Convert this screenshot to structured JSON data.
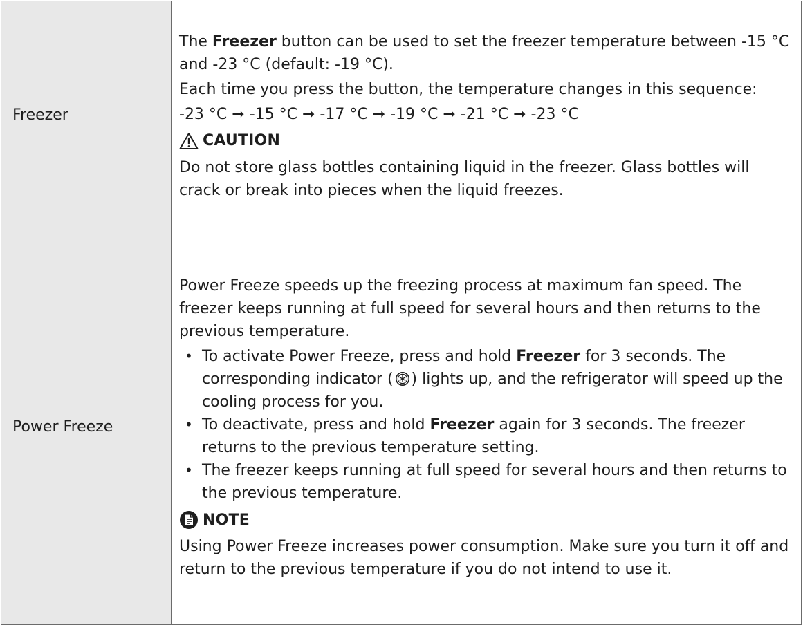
{
  "rows": [
    {
      "label": "Freezer",
      "p1_pre": "The ",
      "p1_bold": "Freezer",
      "p1_post": " button can be used to set the freezer temperature between -15 °C and -23 °C (default: -19 °C).",
      "p2": "Each time you press the button, the temperature changes in this sequence:",
      "sequence": "-23 °C ➞ -15 °C ➞ -17 °C ➞ -19 °C ➞ -21 °C ➞ -23 °C",
      "callout_title": "CAUTION",
      "callout_icon": "warning-triangle-icon",
      "callout_text": "Do not store glass bottles containing liquid in the freezer. Glass bottles will crack or break into pieces when the liquid freezes."
    },
    {
      "label": "Power Freeze",
      "intro": "Power Freeze speeds up the freezing process at maximum fan speed. The freezer keeps running at full speed for several hours and then returns to the previous temperature.",
      "bullet_symbol": "•",
      "bullets": [
        {
          "pre": "To activate Power Freeze, press and hold ",
          "bold": "Freezer",
          "mid": " for 3 seconds. The corresponding indicator (",
          "icon": "power-freeze-indicator-icon",
          "post": ") lights up, and the refrigerator will speed up the cooling process for you."
        },
        {
          "pre": "To deactivate, press and hold ",
          "bold": "Freezer",
          "post": " again for 3 seconds. The freezer returns to the previous temperature setting."
        },
        {
          "text": "The freezer keeps running at full speed for several hours and then returns to the previous temperature."
        }
      ],
      "callout_title": "NOTE",
      "callout_icon": "note-document-icon",
      "callout_text": "Using Power Freeze increases power consumption. Make sure you turn it off and return to the previous temperature if you do not intend to use it."
    }
  ],
  "colors": {
    "label_bg": "#e8e8e8",
    "border": "#6b6b6b",
    "text": "#1e1e1e"
  }
}
